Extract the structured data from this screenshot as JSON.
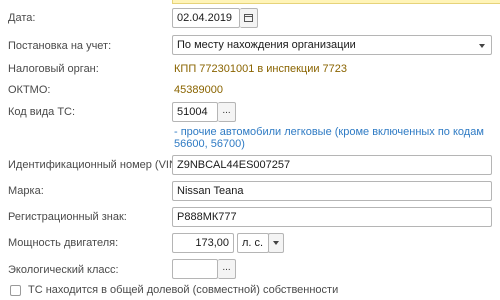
{
  "date": {
    "label": "Дата:",
    "value": "02.04.2019"
  },
  "registration": {
    "label": "Постановка на учет:",
    "value": "По месту нахождения организации"
  },
  "tax_authority": {
    "label": "Налоговый орган:",
    "value": "КПП 772301001 в инспекции 7723"
  },
  "oktmo": {
    "label": "ОКТМО:",
    "value": "45389000"
  },
  "vehicle_type": {
    "label": "Код вида ТС:",
    "value": "51004",
    "hint_line1": "- прочие автомобили легковые (кроме включенных по кодам",
    "hint_line2": "56600, 56700)"
  },
  "vin": {
    "label": "Идентификационный номер (VIN):",
    "value": "Z9NBCAL44ES007257"
  },
  "brand": {
    "label": "Марка:",
    "value": "Nissan Teana"
  },
  "reg_mark": {
    "label": "Регистрационный знак:",
    "value": "Р888МК777"
  },
  "engine_power": {
    "label": "Мощность двигателя:",
    "value": "173,00",
    "unit": "л. с."
  },
  "eco_class": {
    "label": "Экологический класс:",
    "value": ""
  },
  "shared_ownership": {
    "label": "ТС находится в общей долевой (совместной) собственности",
    "checked": false
  },
  "icons": {
    "calendar": "calendar-icon",
    "dropdown": "chevron-down-icon",
    "select": "ellipsis-icon"
  },
  "colors": {
    "value_text": "#8a6400",
    "hint_text": "#2f7bc4",
    "highlight": "#fff4b8"
  }
}
